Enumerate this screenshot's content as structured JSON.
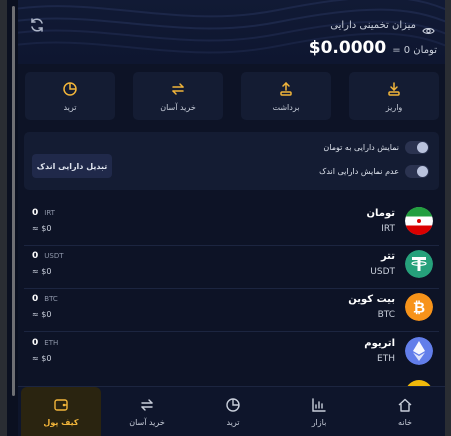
{
  "header": {
    "asset_label": "میزان تخمینی دارایی",
    "balance_main": "$0.0000",
    "balance_sub": "= 0 تومان"
  },
  "actions": [
    {
      "label": "واریز",
      "icon": "deposit-icon"
    },
    {
      "label": "برداشت",
      "icon": "withdraw-icon"
    },
    {
      "label": "خرید آسان",
      "icon": "swap-icon"
    },
    {
      "label": "ترید",
      "icon": "pie-chart-icon"
    }
  ],
  "settings": {
    "toggle_toman": "نمایش دارایی به تومان",
    "toggle_small": "عدم نمایش دارایی اندک",
    "convert_button": "تبدیل دارایی اندک"
  },
  "assets": [
    {
      "name": "تومان",
      "symbol": "IRT",
      "amount": "0",
      "amount_symbol": "IRT",
      "usd": "≈ $0"
    },
    {
      "name": "تتر",
      "symbol": "USDT",
      "amount": "0",
      "amount_symbol": "USDT",
      "usd": "≈ $0"
    },
    {
      "name": "بیت کوین",
      "symbol": "BTC",
      "amount": "0",
      "amount_symbol": "BTC",
      "usd": "≈ $0"
    },
    {
      "name": "اتریوم",
      "symbol": "ETH",
      "amount": "0",
      "amount_symbol": "ETH",
      "usd": "≈ $0"
    }
  ],
  "nav": [
    {
      "label": "خانه",
      "icon": "home-icon"
    },
    {
      "label": "بازار",
      "icon": "market-icon"
    },
    {
      "label": "ترید",
      "icon": "pie-chart-icon"
    },
    {
      "label": "خرید آسان",
      "icon": "swap-icon"
    },
    {
      "label": "کیف پول",
      "icon": "wallet-icon",
      "active": true
    }
  ],
  "colors": {
    "accent": "#f2b53a",
    "background": "#0d1326",
    "card": "#141c33",
    "tether": "#26a17b",
    "bitcoin": "#f7931a",
    "ethereum": "#627eea"
  }
}
